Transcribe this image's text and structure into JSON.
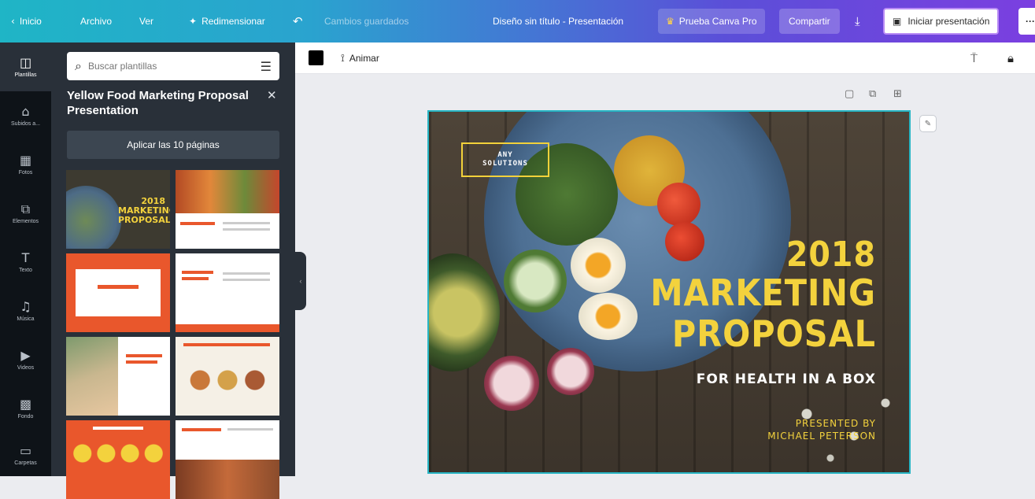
{
  "topbar": {
    "home": "Inicio",
    "file": "Archivo",
    "view": "Ver",
    "resize": "Redimensionar",
    "undo_icon": "undo-icon",
    "saved_status": "Cambios guardados",
    "doc_title": "Diseño sin título - Presentación",
    "try_pro": "Prueba Canva Pro",
    "share": "Compartir",
    "download_icon": "download-icon",
    "present": "Iniciar presentación",
    "more": "···"
  },
  "rail": [
    {
      "label": "Plantillas",
      "icon": "templates-icon",
      "glyph": "◫"
    },
    {
      "label": "Subidos a...",
      "icon": "uploads-icon",
      "glyph": "⌂"
    },
    {
      "label": "Fotos",
      "icon": "photos-icon",
      "glyph": "▦"
    },
    {
      "label": "Elementos",
      "icon": "elements-icon",
      "glyph": "⧉"
    },
    {
      "label": "Texto",
      "icon": "text-icon",
      "glyph": "T"
    },
    {
      "label": "Música",
      "icon": "music-icon",
      "glyph": "♫"
    },
    {
      "label": "Videos",
      "icon": "videos-icon",
      "glyph": "▶"
    },
    {
      "label": "Fondo",
      "icon": "background-icon",
      "glyph": "▩"
    },
    {
      "label": "Carpetas",
      "icon": "folders-icon",
      "glyph": "▭"
    }
  ],
  "panel": {
    "search_placeholder": "Buscar plantillas",
    "template_title": "Yellow Food Marketing Proposal Presentation",
    "apply_label": "Aplicar las 10 páginas"
  },
  "thumbnails": [
    {
      "name": "thumb-1",
      "heading": "2018 MARKETING PROPOSAL",
      "bg": "#3d3a30",
      "accent": "#f3d23d"
    },
    {
      "name": "thumb-2",
      "heading": "",
      "bg": "#ffffff",
      "accent": "#e9572c"
    },
    {
      "name": "thumb-3",
      "heading": "",
      "bg": "#e9572c",
      "accent": "#ffffff"
    },
    {
      "name": "thumb-4",
      "heading": "",
      "bg": "#ffffff",
      "accent": "#e9572c"
    },
    {
      "name": "thumb-5",
      "heading": "",
      "bg": "#ffffff",
      "accent": "#e9572c"
    },
    {
      "name": "thumb-6",
      "heading": "",
      "bg": "#f5f0e6",
      "accent": "#e9572c"
    },
    {
      "name": "thumb-7",
      "heading": "",
      "bg": "#e9572c",
      "accent": "#f3d23d"
    },
    {
      "name": "thumb-8",
      "heading": "",
      "bg": "#ffffff",
      "accent": "#e9572c"
    }
  ],
  "editor": {
    "animate": "Animar"
  },
  "slide": {
    "logo_line1": "ANY",
    "logo_line2": "SOLUTIONS",
    "year": "2018",
    "line_marketing": "MARKETING",
    "line_proposal": "PROPOSAL",
    "subline": "FOR HEALTH IN A BOX",
    "presented_by": "PRESENTED BY",
    "presenter": "MICHAEL PETERSON"
  },
  "colors": {
    "accent_yellow": "#f3d23d",
    "selection": "#27b5c4",
    "rail_bg": "#0e1318",
    "panel_bg": "#293039"
  }
}
